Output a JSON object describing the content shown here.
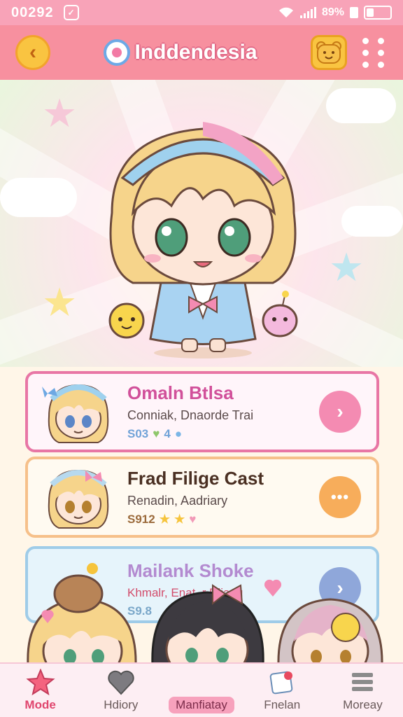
{
  "status_bar": {
    "time": "00292",
    "battery": "89%"
  },
  "header": {
    "title": "Inddendesia"
  },
  "cards": [
    {
      "name": "Omaln Btlsa",
      "subtitle": "Conniak, Dnaorde Trai",
      "stats": "S03",
      "stat2": "4",
      "accent": "#e876a5"
    },
    {
      "name": "Frad Filige Cast",
      "subtitle": "Renadin, Aadriary",
      "stats": "S912",
      "accent": "#f6c08a"
    },
    {
      "name": "Mailank Shoke",
      "subtitle": "Khmalr, Enat..r Dliagg",
      "stats": "S9.8",
      "accent": "#9fcce8"
    }
  ],
  "nav": [
    {
      "label": "Mode",
      "icon": "star-icon",
      "active": true
    },
    {
      "label": "Hdiory",
      "icon": "heart-icon"
    },
    {
      "label": "Manfiatay",
      "icon": "character-icon"
    },
    {
      "label": "Fnelan",
      "icon": "cards-icon"
    },
    {
      "label": "Moreay",
      "icon": "stack-icon"
    }
  ]
}
